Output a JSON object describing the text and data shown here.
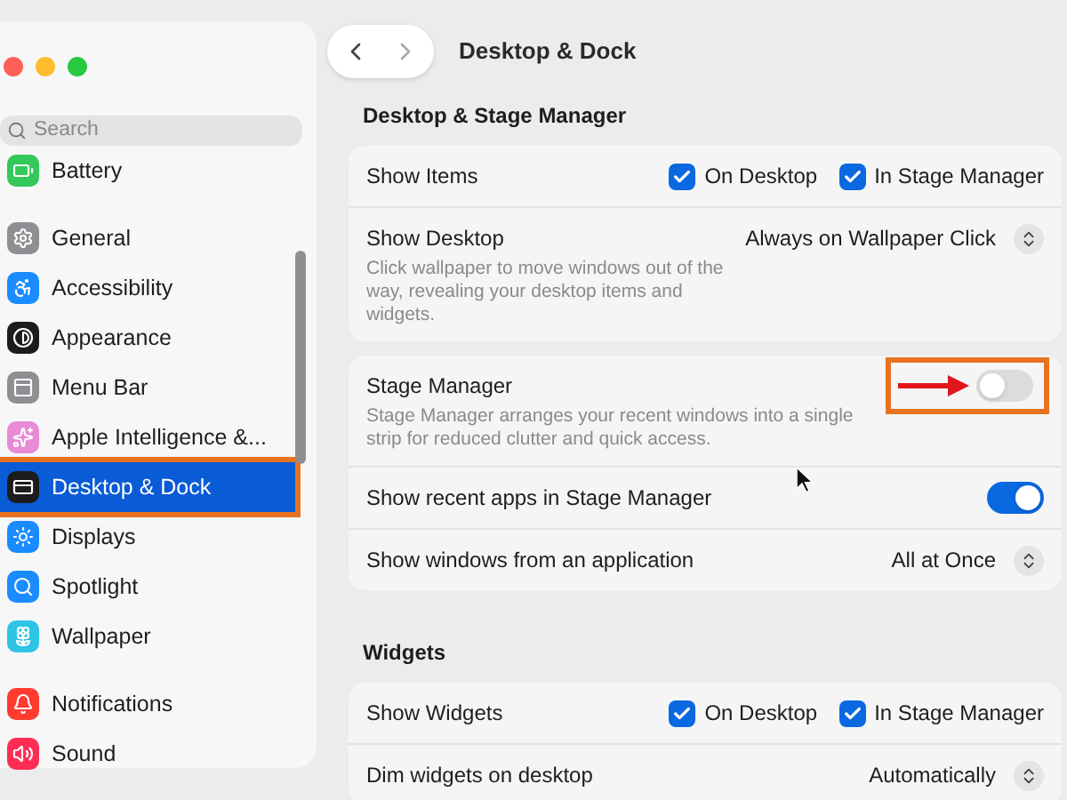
{
  "window": {
    "title": "Desktop & Dock"
  },
  "sidebar": {
    "search": {
      "placeholder": "Search"
    },
    "groups": [
      [
        {
          "label": "Battery",
          "color": "#34c759",
          "selected": false,
          "highlighted": false
        }
      ],
      [
        {
          "label": "General",
          "color": "#8e8e93",
          "selected": false,
          "highlighted": false
        },
        {
          "label": "Accessibility",
          "color": "#1a8cff",
          "selected": false,
          "highlighted": false
        },
        {
          "label": "Appearance",
          "color": "#1c1c1e",
          "selected": false,
          "highlighted": false
        },
        {
          "label": "Menu Bar",
          "color": "#8e8e93",
          "selected": false,
          "highlighted": false
        },
        {
          "label": "Apple Intelligence &...",
          "color": "#e88ad6",
          "selected": false,
          "highlighted": false
        },
        {
          "label": "Desktop & Dock",
          "color": "#1c1c1e",
          "selected": true,
          "highlighted": true
        },
        {
          "label": "Displays",
          "color": "#1a8cff",
          "selected": false,
          "highlighted": false
        },
        {
          "label": "Spotlight",
          "color": "#1a8cff",
          "selected": false,
          "highlighted": false
        },
        {
          "label": "Wallpaper",
          "color": "#2ec4e6",
          "selected": false,
          "highlighted": false
        }
      ],
      [
        {
          "label": "Notifications",
          "color": "#ff3b30",
          "selected": false,
          "highlighted": false
        },
        {
          "label": "Sound",
          "color": "#ff2d55",
          "selected": false,
          "highlighted": false
        }
      ]
    ]
  },
  "sections": [
    {
      "title": "Desktop & Stage Manager",
      "rows": [
        {
          "kind": "checks",
          "label": "Show Items",
          "checks": [
            {
              "label": "On Desktop",
              "checked": true
            },
            {
              "label": "In Stage Manager",
              "checked": true
            }
          ]
        },
        {
          "kind": "popup",
          "label": "Show Desktop",
          "description": "Click wallpaper to move windows out of the way, revealing your desktop items and widgets.",
          "value": "Always on Wallpaper Click"
        }
      ]
    },
    {
      "rows": [
        {
          "kind": "toggle",
          "label": "Stage Manager",
          "description": "Stage Manager arranges your recent windows into a single strip for reduced clutter and quick access.",
          "on": false,
          "highlighted": true
        },
        {
          "kind": "toggle",
          "label": "Show recent apps in Stage Manager",
          "on": true,
          "highlighted": false
        },
        {
          "kind": "popup",
          "label": "Show windows from an application",
          "value": "All at Once"
        }
      ]
    },
    {
      "title": "Widgets",
      "rows": [
        {
          "kind": "checks",
          "label": "Show Widgets",
          "checks": [
            {
              "label": "On Desktop",
              "checked": true
            },
            {
              "label": "In Stage Manager",
              "checked": true
            }
          ]
        },
        {
          "kind": "popup",
          "label": "Dim widgets on desktop",
          "value": "Automatically"
        }
      ]
    }
  ]
}
